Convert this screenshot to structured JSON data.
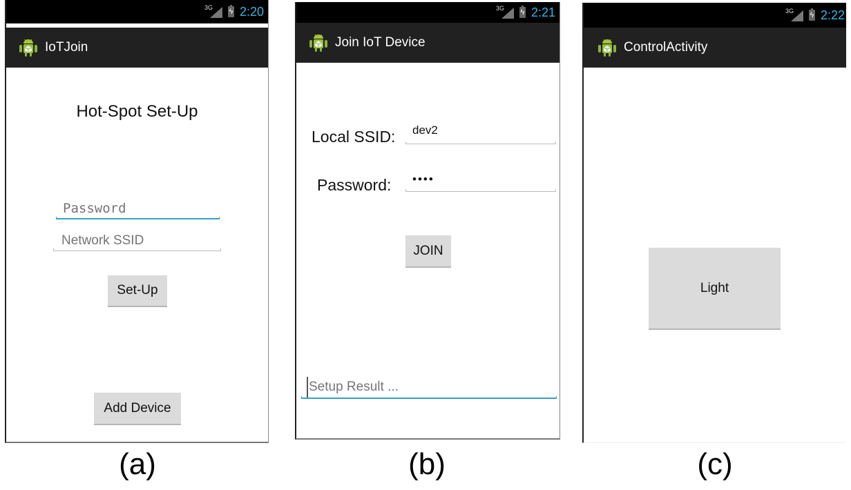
{
  "figure": {
    "captions": [
      "(a)",
      "(b)",
      "(c)"
    ]
  },
  "screens": [
    {
      "status": {
        "network": "3G",
        "time": "2:20"
      },
      "title": "IoTJoin",
      "heading": "Hot-Spot Set-Up",
      "password_placeholder": "Password",
      "ssid_placeholder": "Network SSID",
      "setup_button": "Set-Up",
      "add_device_button": "Add Device"
    },
    {
      "status": {
        "network": "3G",
        "time": "2:21"
      },
      "title": "Join IoT Device",
      "ssid_label": "Local SSID:",
      "ssid_value": "dev2",
      "password_label": "Password:",
      "password_value": "••••",
      "join_button": "JOIN",
      "result_placeholder": "Setup Result ..."
    },
    {
      "status": {
        "network": "3G",
        "time": "2:22"
      },
      "title": "ControlActivity",
      "light_button": "Light"
    }
  ],
  "colors": {
    "accent": "#33b5e5",
    "actionbar": "#212121",
    "button": "#dcdbdc"
  }
}
